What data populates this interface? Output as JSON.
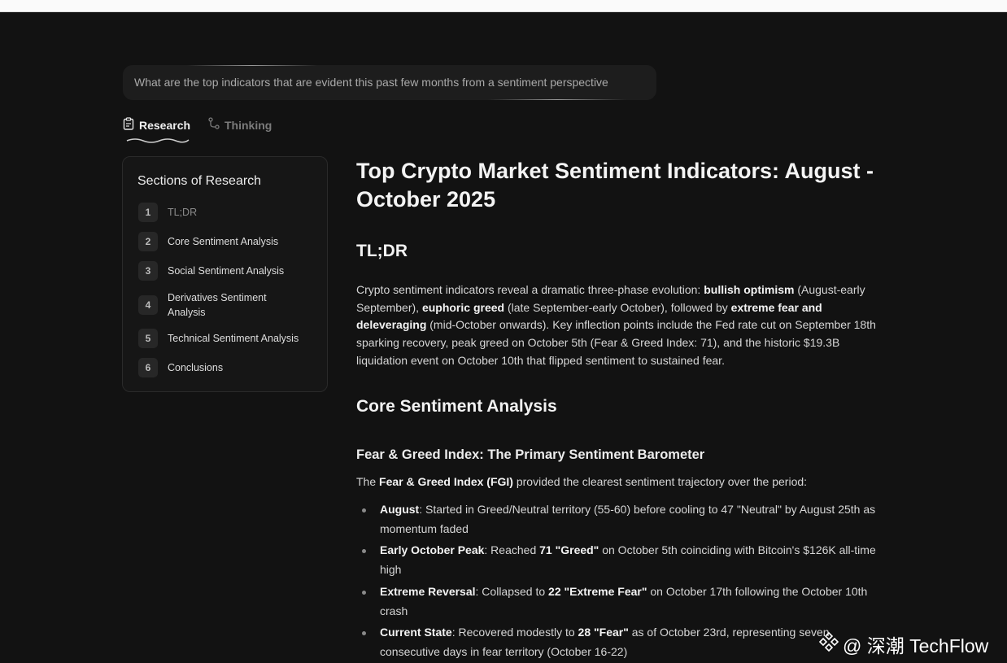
{
  "query": {
    "text": "What are the top indicators that are evident this past few months from a sentiment perspective"
  },
  "tabs": [
    {
      "label": "Research",
      "icon": "clipboard-icon",
      "active": true
    },
    {
      "label": "Thinking",
      "icon": "branch-icon",
      "active": false
    }
  ],
  "sidebar": {
    "title": "Sections of Research",
    "items": [
      {
        "num": "1",
        "label": "TL;DR"
      },
      {
        "num": "2",
        "label": "Core Sentiment Analysis"
      },
      {
        "num": "3",
        "label": "Social Sentiment Analysis"
      },
      {
        "num": "4",
        "label": "Derivatives Sentiment Analysis"
      },
      {
        "num": "5",
        "label": "Technical Sentiment Analysis"
      },
      {
        "num": "6",
        "label": "Conclusions"
      }
    ]
  },
  "article": {
    "title": "Top Crypto Market Sentiment Indicators: August - October 2025",
    "tldr_heading": "TL;DR",
    "tldr": {
      "p1": "Crypto sentiment indicators reveal a dramatic three-phase evolution: ",
      "b1": "bullish optimism",
      "p2": " (August-early September), ",
      "b2": "euphoric greed",
      "p3": " (late September-early October), followed by ",
      "b3": "extreme fear and deleveraging",
      "p4": " (mid-October onwards). Key inflection points include the Fed rate cut on September 18th sparking recovery, peak greed on October 5th (Fear & Greed Index: 71), and the historic $19.3B liquidation event on October 10th that flipped sentiment to sustained fear."
    },
    "core_heading": "Core Sentiment Analysis",
    "fgi_heading": "Fear & Greed Index: The Primary Sentiment Barometer",
    "fgi_intro": {
      "p1": "The ",
      "b1": "Fear & Greed Index (FGI)",
      "p2": " provided the clearest sentiment trajectory over the period:"
    },
    "bullets": [
      {
        "b1": "August",
        "t1": ": Started in Greed/Neutral territory (55-60) before cooling to 47 \"Neutral\" by August 25th as momentum faded",
        "b2": "",
        "t2": ""
      },
      {
        "b1": "Early October Peak",
        "t1": ": Reached ",
        "b2": "71 \"Greed\"",
        "t2": " on October 5th coinciding with Bitcoin's $126K all-time high"
      },
      {
        "b1": "Extreme Reversal",
        "t1": ": Collapsed to ",
        "b2": "22 \"Extreme Fear\"",
        "t2": " on October 17th following the October 10th crash"
      },
      {
        "b1": "Current State",
        "t1": ": Recovered modestly to ",
        "b2": "28 \"Fear\"",
        "t2": " as of October 23rd, representing seven consecutive days in fear territory (October 16-22)"
      }
    ]
  },
  "watermark": {
    "text": "@ 深潮 TechFlow",
    "icon": "techflow-logo-icon"
  },
  "colors": {
    "background": "#121212",
    "panel": "#161616",
    "text": "#e6e6e6"
  }
}
